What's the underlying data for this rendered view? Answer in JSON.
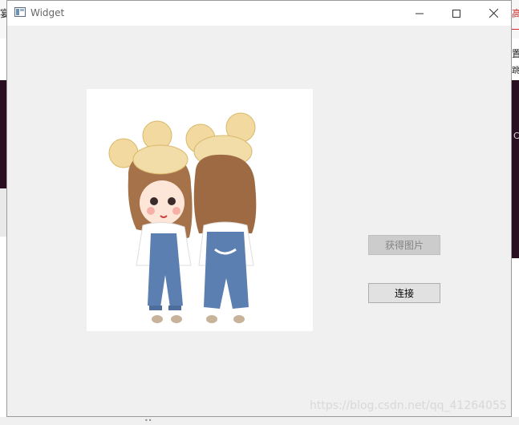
{
  "window": {
    "title": "Widget",
    "controls": {
      "minimize_icon": "minimize-icon",
      "maximize_icon": "maximize-icon",
      "close_icon": "close-icon"
    }
  },
  "main": {
    "image_alt": "cartoon-girls-illustration",
    "buttons": {
      "get_image": "获得图片",
      "connect": "连接"
    }
  },
  "background": {
    "left_char": "宴",
    "right_char_top": "高",
    "right_char_mid": "置",
    "right_char_mid2": "跳",
    "right_char_low": "C"
  },
  "watermark": "https://blog.csdn.net/qq_41264055",
  "colors": {
    "window_bg": "#f0f0f0",
    "button_bg": "#e1e1e1",
    "disabled_text": "#838383",
    "desktop_dark": "#2a0f22"
  }
}
